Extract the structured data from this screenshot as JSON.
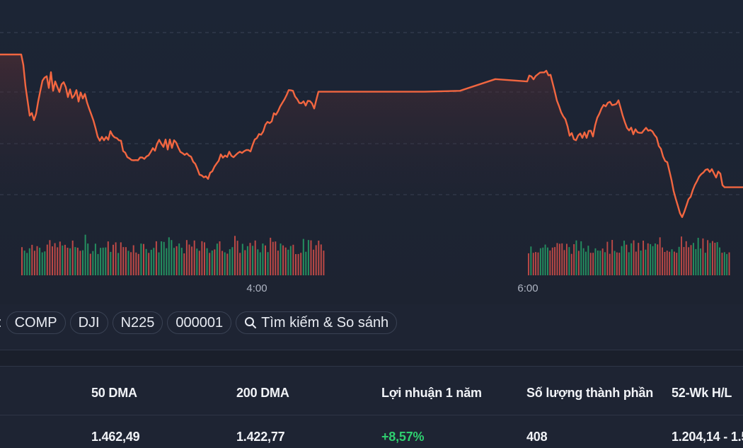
{
  "chart_data": {
    "type": "line",
    "line_color": "#f26640",
    "volume_up_color": "#26a269",
    "volume_down_color": "#d8504a",
    "x_ticks": [
      "4:00",
      "6:00"
    ],
    "grid": "dashed horizontal",
    "price_series": {
      "x": [
        0,
        6,
        12,
        18,
        24,
        30,
        33,
        36,
        39,
        42,
        45,
        48,
        51,
        54,
        57,
        60,
        63,
        66,
        69,
        72,
        75,
        78,
        81,
        84,
        87,
        90,
        93,
        96,
        99,
        102,
        105,
        108,
        111,
        114,
        117,
        120,
        123,
        126,
        129,
        132,
        135,
        138,
        141,
        144,
        147,
        150,
        153,
        156,
        159,
        162,
        165,
        168,
        171,
        174,
        177,
        180,
        183,
        186,
        189,
        192,
        195,
        198,
        201,
        204,
        207,
        210,
        213,
        216,
        219,
        222,
        225,
        228,
        231,
        234,
        237,
        240,
        243,
        246,
        249,
        252,
        255,
        258,
        261,
        264,
        267,
        270,
        273,
        276,
        279,
        282,
        285,
        288,
        291,
        294,
        297,
        300,
        303,
        306,
        309,
        312,
        315,
        318,
        321,
        324,
        327,
        330,
        333,
        336,
        339,
        342,
        345,
        348,
        351,
        354,
        357,
        360,
        363,
        366,
        369,
        372,
        375,
        378,
        381,
        384,
        387,
        390,
        393,
        396,
        399,
        402,
        405,
        408,
        411,
        414,
        417,
        420,
        423,
        426,
        429,
        432,
        435,
        438,
        441,
        444,
        447,
        450,
        453,
        456,
        459,
        462,
        500,
        550,
        600,
        650,
        700,
        745,
        748,
        751,
        754,
        757,
        760,
        763,
        766,
        769,
        772,
        775,
        778,
        781,
        784,
        787,
        790,
        793,
        796,
        799,
        802,
        805,
        808,
        811,
        814,
        817,
        820,
        823,
        826,
        829,
        832,
        835,
        838,
        841,
        844,
        847,
        850,
        853,
        856,
        859,
        862,
        865,
        868,
        871,
        874,
        877,
        880,
        883,
        886,
        889,
        892,
        895,
        898,
        901,
        904,
        907,
        910,
        913,
        916,
        919,
        922,
        925,
        928,
        931,
        934,
        937,
        940,
        943,
        946,
        949,
        952,
        955,
        958,
        961,
        964,
        967,
        970,
        973,
        976,
        979,
        982,
        985,
        988,
        991,
        994,
        997,
        1000,
        1003,
        1006,
        1009,
        1012,
        1015,
        1018,
        1021,
        1024,
        1027,
        1030,
        1040,
        1050
      ],
      "y": [
        1476.0,
        1476.0,
        1476.0,
        1476.0,
        1476.0,
        1476.0,
        1471.6,
        1462.8,
        1456.6,
        1450.4,
        1451.5,
        1448.5,
        1451.2,
        1456.4,
        1460.8,
        1465.0,
        1466.3,
        1466.9,
        1462.0,
        1468.6,
        1460.8,
        1464.7,
        1462.4,
        1460.3,
        1463.5,
        1464.4,
        1462.3,
        1458.2,
        1461.4,
        1457.8,
        1458.9,
        1461.1,
        1456.3,
        1460.1,
        1457.6,
        1459.5,
        1455.9,
        1453.3,
        1450.9,
        1448.4,
        1445.2,
        1441.6,
        1439.9,
        1441.5,
        1440.1,
        1441.5,
        1440.3,
        1443.9,
        1442.2,
        1441.3,
        1441.0,
        1440.1,
        1439.9,
        1435.6,
        1434.9,
        1433.0,
        1432.5,
        1431.8,
        1431.7,
        1431.8,
        1431.7,
        1432.9,
        1432.9,
        1432.3,
        1433.3,
        1433.8,
        1435.2,
        1436.8,
        1435.7,
        1438.6,
        1440.3,
        1438.6,
        1437.3,
        1440.4,
        1436.2,
        1440.4,
        1436.9,
        1440.1,
        1439.1,
        1437.0,
        1435.2,
        1434.7,
        1434.0,
        1434.6,
        1433.7,
        1433.2,
        1431.1,
        1430.2,
        1428.1,
        1425.7,
        1425.4,
        1424.6,
        1425.0,
        1423.9,
        1426.5,
        1427.1,
        1429.0,
        1430.3,
        1431.5,
        1434.2,
        1432.8,
        1433.7,
        1433.1,
        1435.3,
        1433.6,
        1433.0,
        1433.9,
        1434.7,
        1435.3,
        1434.8,
        1435.5,
        1436.0,
        1436.0,
        1435.4,
        1438.1,
        1440.4,
        1441.0,
        1442.7,
        1442.4,
        1443.8,
        1446.6,
        1447.8,
        1447.3,
        1448.0,
        1451.4,
        1450.8,
        1452.3,
        1454.3,
        1455.8,
        1457.2,
        1459.0,
        1461.1,
        1461.0,
        1460.8,
        1458.4,
        1457.3,
        1455.7,
        1455.6,
        1456.4,
        1454.6,
        1456.6,
        1456.5,
        1455.5,
        1453.4,
        1457.0,
        1460.4,
        1460.4,
        1460.4,
        1460.4,
        1460.4,
        1460.4,
        1460.4,
        1460.4,
        1460.8,
        1465.7,
        1464.7,
        1467.2,
        1466.8,
        1465.6,
        1467.0,
        1467.7,
        1468.4,
        1468.5,
        1468.5,
        1469.2,
        1467.3,
        1467.5,
        1464.0,
        1460.5,
        1456.7,
        1454.4,
        1451.8,
        1450.1,
        1448.9,
        1446.0,
        1442.0,
        1443.1,
        1440.5,
        1440.1,
        1442.1,
        1442.9,
        1441.1,
        1443.4,
        1441.1,
        1444.0,
        1444.1,
        1441.7,
        1446.3,
        1449.5,
        1451.2,
        1453.4,
        1454.9,
        1454.3,
        1455.8,
        1456.2,
        1454.8,
        1455.0,
        1455.3,
        1456.8,
        1453.7,
        1450.4,
        1447.7,
        1445.3,
        1444.2,
        1445.4,
        1442.6,
        1444.7,
        1443.4,
        1443.2,
        1443.2,
        1444.3,
        1445.3,
        1444.1,
        1444.4,
        1443.8,
        1442.3,
        1441.2,
        1437.7,
        1436.5,
        1433.3,
        1431.4,
        1430.9,
        1427.2,
        1423.4,
        1418.8,
        1415.6,
        1412.6,
        1409.5,
        1407.9,
        1410.1,
        1412.7,
        1415.4,
        1416.4,
        1419.2,
        1421.4,
        1423.0,
        1424.9,
        1425.9,
        1426.6,
        1427.7,
        1428.0,
        1426.8,
        1428.0,
        1426.2,
        1424.5,
        1427.0,
        1426.1,
        1421.3,
        1420.4,
        1420.4,
        1420.4,
        1420.4,
        1420.4
      ]
    },
    "y_range": [
      1404,
      1484
    ],
    "volume_series": [
      {
        "x_start": 30,
        "x_end": 460,
        "count": 120
      },
      {
        "x_start": 746,
        "x_end": 1033,
        "count": 85
      }
    ]
  },
  "compare": {
    "lead": ":",
    "chips": [
      "COMP",
      "DJI",
      "N225",
      "000001"
    ],
    "search_label": "Tìm kiếm & So sánh"
  },
  "table": {
    "headers": [
      "50 DMA",
      "200 DMA",
      "Lợi nhuận 1 năm",
      "Số lượng thành phần",
      "52-Wk H/L"
    ],
    "values": [
      "1.462,49",
      "1.422,77",
      "+8,57%",
      "408",
      "1.204,14 - 1.5"
    ]
  }
}
